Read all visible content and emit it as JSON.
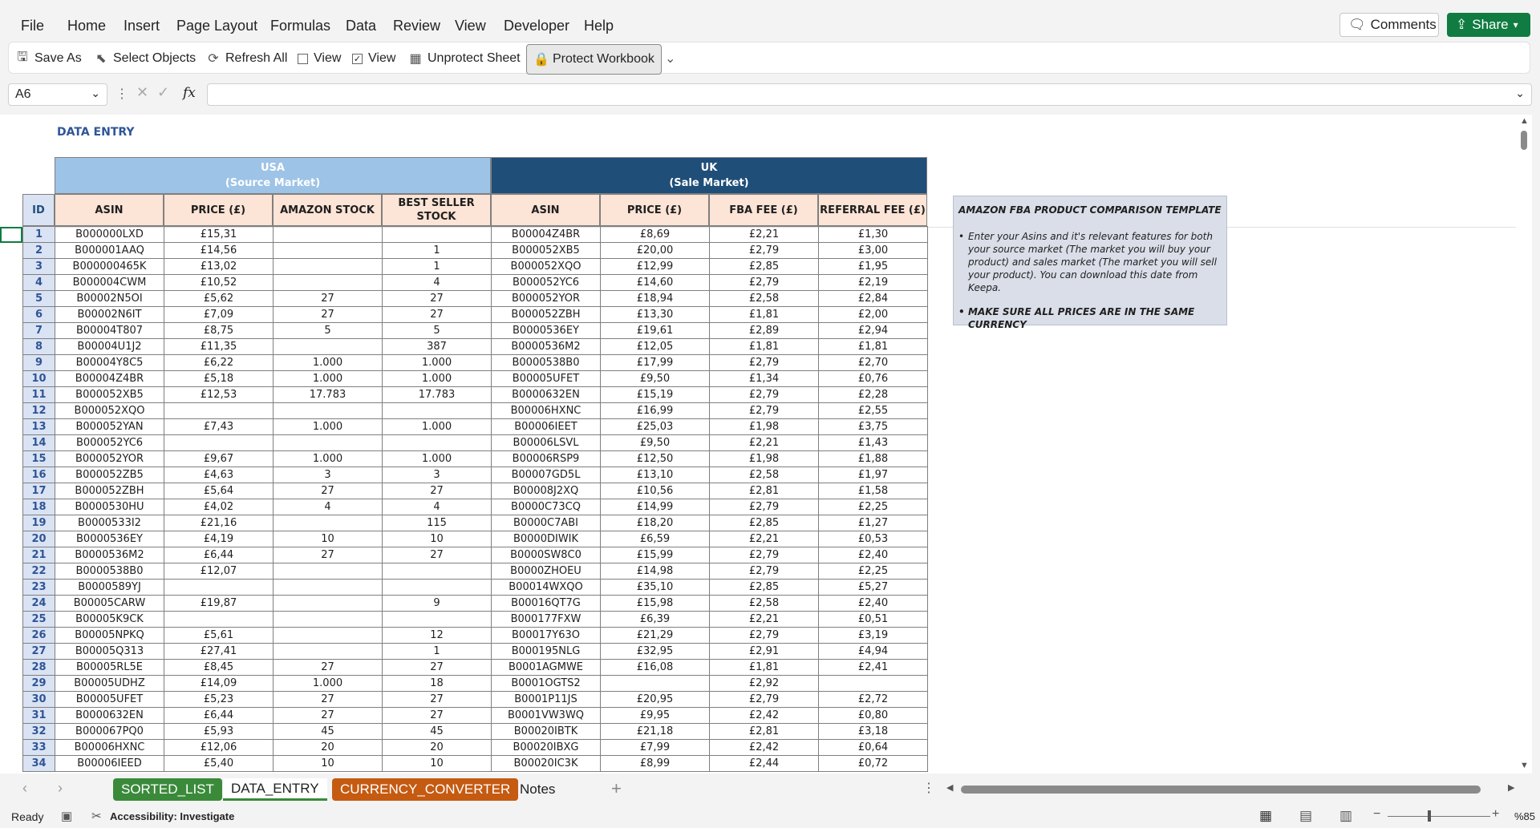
{
  "menu": [
    "File",
    "Home",
    "Insert",
    "Page Layout",
    "Formulas",
    "Data",
    "Review",
    "View",
    "Developer",
    "Help"
  ],
  "top_buttons": {
    "comments": "Comments",
    "share": "Share"
  },
  "ribbon": {
    "save_as": "Save As",
    "select_objects": "Select Objects",
    "refresh_all": "Refresh All",
    "view1": "View",
    "view2": "View",
    "unprotect_sheet": "Unprotect Sheet",
    "protect_workbook": "Protect Workbook"
  },
  "formula_bar": {
    "name_box": "A6",
    "fx": "fx",
    "value": ""
  },
  "sheet": {
    "title": "DATA ENTRY",
    "usa_header": [
      "USA",
      "(Source Market)"
    ],
    "uk_header": [
      "UK",
      "(Sale Market)"
    ],
    "columns": {
      "id": "ID",
      "asin_usa": "ASIN",
      "price_usa": "PRICE (£)",
      "amazon_stock": "AMAZON STOCK",
      "best_seller_stock": "BEST SELLER STOCK",
      "asin_uk": "ASIN",
      "price_uk": "PRICE (£)",
      "fba_fee": "FBA FEE (£)",
      "referral_fee": "REFERRAL FEE (£)"
    },
    "rows": [
      [
        "1",
        "B000000LXD",
        "£15,31",
        "",
        "",
        "B00004Z4BR",
        "£8,69",
        "£2,21",
        "£1,30"
      ],
      [
        "2",
        "B000001AAQ",
        "£14,56",
        "",
        "1",
        "B000052XB5",
        "£20,00",
        "£2,79",
        "£3,00"
      ],
      [
        "3",
        "B000000465K",
        "£13,02",
        "",
        "1",
        "B000052XQO",
        "£12,99",
        "£2,85",
        "£1,95"
      ],
      [
        "4",
        "B000004CWM",
        "£10,52",
        "",
        "4",
        "B000052YC6",
        "£14,60",
        "£2,79",
        "£2,19"
      ],
      [
        "5",
        "B00002N5OI",
        "£5,62",
        "27",
        "27",
        "B000052YOR",
        "£18,94",
        "£2,58",
        "£2,84"
      ],
      [
        "6",
        "B00002N6IT",
        "£7,09",
        "27",
        "27",
        "B000052ZBH",
        "£13,30",
        "£1,81",
        "£2,00"
      ],
      [
        "7",
        "B00004T807",
        "£8,75",
        "5",
        "5",
        "B0000536EY",
        "£19,61",
        "£2,89",
        "£2,94"
      ],
      [
        "8",
        "B00004U1J2",
        "£11,35",
        "",
        "387",
        "B0000536M2",
        "£12,05",
        "£1,81",
        "£1,81"
      ],
      [
        "9",
        "B00004Y8C5",
        "£6,22",
        "1.000",
        "1.000",
        "B0000538B0",
        "£17,99",
        "£2,79",
        "£2,70"
      ],
      [
        "10",
        "B00004Z4BR",
        "£5,18",
        "1.000",
        "1.000",
        "B00005UFET",
        "£9,50",
        "£1,34",
        "£0,76"
      ],
      [
        "11",
        "B000052XB5",
        "£12,53",
        "17.783",
        "17.783",
        "B0000632EN",
        "£15,19",
        "£2,79",
        "£2,28"
      ],
      [
        "12",
        "B000052XQO",
        "",
        "",
        "",
        "B00006HXNC",
        "£16,99",
        "£2,79",
        "£2,55"
      ],
      [
        "13",
        "B000052YAN",
        "£7,43",
        "1.000",
        "1.000",
        "B00006IEET",
        "£25,03",
        "£1,98",
        "£3,75"
      ],
      [
        "14",
        "B000052YC6",
        "",
        "",
        "",
        "B00006LSVL",
        "£9,50",
        "£2,21",
        "£1,43"
      ],
      [
        "15",
        "B000052YOR",
        "£9,67",
        "1.000",
        "1.000",
        "B00006RSP9",
        "£12,50",
        "£1,98",
        "£1,88"
      ],
      [
        "16",
        "B000052ZB5",
        "£4,63",
        "3",
        "3",
        "B00007GD5L",
        "£13,10",
        "£2,58",
        "£1,97"
      ],
      [
        "17",
        "B000052ZBH",
        "£5,64",
        "27",
        "27",
        "B00008J2XQ",
        "£10,56",
        "£2,81",
        "£1,58"
      ],
      [
        "18",
        "B0000530HU",
        "£4,02",
        "4",
        "4",
        "B0000C73CQ",
        "£14,99",
        "£2,79",
        "£2,25"
      ],
      [
        "19",
        "B0000533I2",
        "£21,16",
        "",
        "115",
        "B0000C7ABI",
        "£18,20",
        "£2,85",
        "£1,27"
      ],
      [
        "20",
        "B0000536EY",
        "£4,19",
        "10",
        "10",
        "B0000DIWIK",
        "£6,59",
        "£2,21",
        "£0,53"
      ],
      [
        "21",
        "B0000536M2",
        "£6,44",
        "27",
        "27",
        "B0000SW8C0",
        "£15,99",
        "£2,79",
        "£2,40"
      ],
      [
        "22",
        "B0000538B0",
        "£12,07",
        "",
        "",
        "B0000ZHOEU",
        "£14,98",
        "£2,79",
        "£2,25"
      ],
      [
        "23",
        "B0000589YJ",
        "",
        "",
        "",
        "B00014WXQO",
        "£35,10",
        "£2,85",
        "£5,27"
      ],
      [
        "24",
        "B00005CARW",
        "£19,87",
        "",
        "9",
        "B00016QT7G",
        "£15,98",
        "£2,58",
        "£2,40"
      ],
      [
        "25",
        "B00005K9CK",
        "",
        "",
        "",
        "B000177FXW",
        "£6,39",
        "£2,21",
        "£0,51"
      ],
      [
        "26",
        "B00005NPKQ",
        "£5,61",
        "",
        "12",
        "B00017Y63O",
        "£21,29",
        "£2,79",
        "£3,19"
      ],
      [
        "27",
        "B00005Q313",
        "£27,41",
        "",
        "1",
        "B000195NLG",
        "£32,95",
        "£2,91",
        "£4,94"
      ],
      [
        "28",
        "B00005RL5E",
        "£8,45",
        "27",
        "27",
        "B0001AGMWE",
        "£16,08",
        "£1,81",
        "£2,41"
      ],
      [
        "29",
        "B00005UDHZ",
        "£14,09",
        "1.000",
        "18",
        "B0001OGTS2",
        "",
        "£2,92",
        ""
      ],
      [
        "30",
        "B00005UFET",
        "£5,23",
        "27",
        "27",
        "B0001P11JS",
        "£20,95",
        "£2,79",
        "£2,72"
      ],
      [
        "31",
        "B0000632EN",
        "£6,44",
        "27",
        "27",
        "B0001VW3WQ",
        "£9,95",
        "£2,42",
        "£0,80"
      ],
      [
        "32",
        "B000067PQ0",
        "£5,93",
        "45",
        "45",
        "B00020IBTK",
        "£21,18",
        "£2,81",
        "£3,18"
      ],
      [
        "33",
        "B00006HXNC",
        "£12,06",
        "20",
        "20",
        "B00020IBXG",
        "£7,99",
        "£2,42",
        "£0,64"
      ],
      [
        "34",
        "B00006IEED",
        "£5,40",
        "10",
        "10",
        "B00020IC3K",
        "£8,99",
        "£2,44",
        "£0,72"
      ]
    ],
    "note": {
      "title": "AMAZON FBA PRODUCT COMPARISON TEMPLATE",
      "bullet1": "Enter your Asins and it's relevant features for both your source market (The market you will buy your product) and sales market (The market you will sell your product). You can download this date from Keepa.",
      "bullet2": "MAKE SURE ALL PRICES ARE IN THE SAME CURRENCY"
    }
  },
  "tabs": [
    {
      "label": "SORTED_LIST",
      "color": "#3a8a3a"
    },
    {
      "label": "DATA_ENTRY",
      "color": "#ffffff"
    },
    {
      "label": "CURRENCY_CONVERTER",
      "color": "#c55a11"
    },
    {
      "label": "Notes",
      "color": ""
    }
  ],
  "status": {
    "ready": "Ready",
    "accessibility": "Accessibility: Investigate",
    "zoom": "%85"
  }
}
